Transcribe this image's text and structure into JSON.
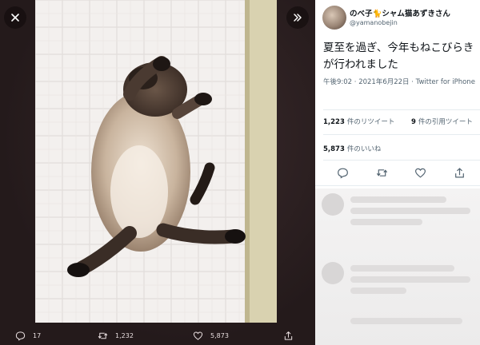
{
  "viewer": {
    "close_icon": "close-icon",
    "expand_icon": "expand-chevron-icon",
    "actions": {
      "reply_count": "17",
      "retweet_count": "1,232",
      "like_count": "5,873"
    }
  },
  "tweet": {
    "display_name": "のべ子🐈シャム猫あずきさん",
    "handle": "@yamanobejin",
    "text": "夏至を過ぎ、今年もねこびらきが行われました",
    "timestamp": "午後9:02 · 2021年6月22日 · Twitter for iPhone",
    "retweets_count": "1,223",
    "retweets_label": "件のリツイート",
    "quotes_count": "9",
    "quotes_label": "件の引用ツイート",
    "likes_count": "5,873",
    "likes_label": "件のいいね"
  },
  "colors": {
    "viewer_bg": "#2b1e20",
    "panel_bg": "#ffffff",
    "text_primary": "#0f1419",
    "text_secondary": "#536471"
  }
}
